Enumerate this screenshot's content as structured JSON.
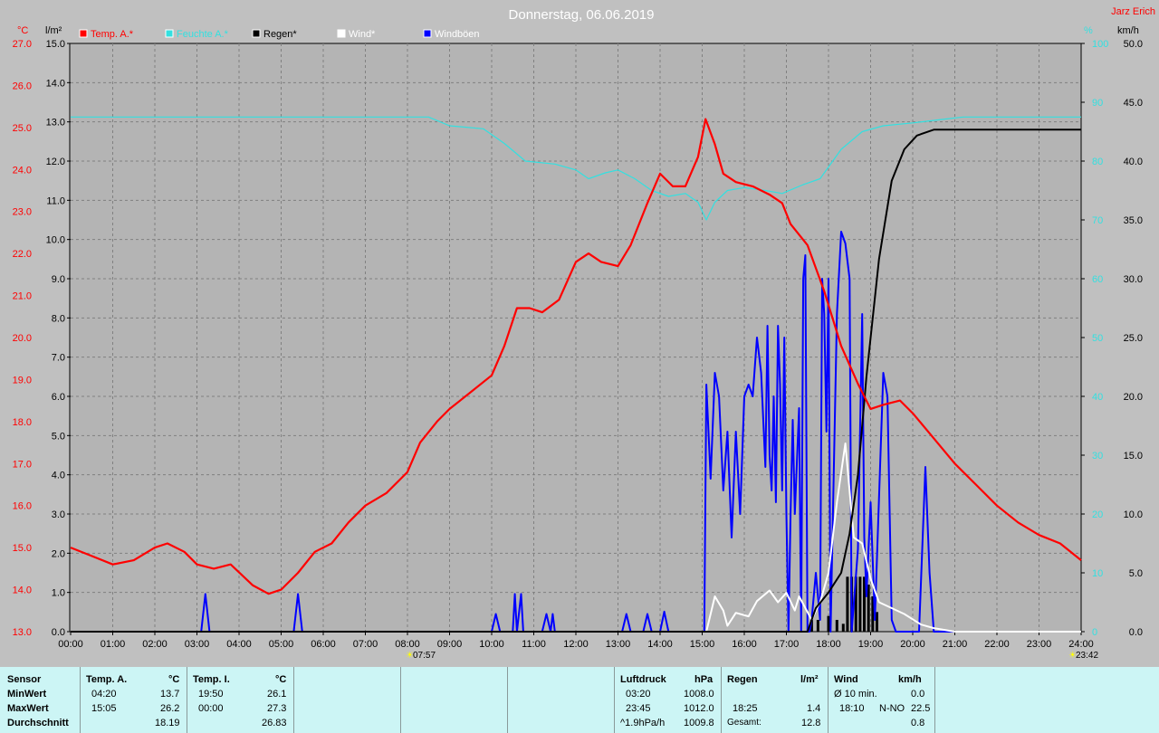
{
  "title": "Donnerstag, 06.06.2019",
  "author": "Jarz Erich",
  "colors": {
    "background": "#c0c0c0",
    "plot_bg": "#b4b4b4",
    "temp": "#ff0000",
    "humidity": "#33e0e0",
    "rain": "#000000",
    "wind": "#ffffff",
    "gusts": "#0000ff",
    "stats_bg": "#ccf5f5"
  },
  "axes": {
    "left_temp_unit": "°C",
    "left_rain_unit": "l/m²",
    "right_hum_unit": "%",
    "right_wind_unit": "km/h",
    "temp_ticks": [
      "27.0",
      "26.0",
      "25.0",
      "24.0",
      "23.0",
      "22.0",
      "21.0",
      "20.0",
      "19.0",
      "18.0",
      "17.0",
      "16.0",
      "15.0",
      "14.0",
      "13.0"
    ],
    "rain_ticks": [
      "15.0",
      "14.0",
      "13.0",
      "12.0",
      "11.0",
      "10.0",
      "9.0",
      "8.0",
      "7.0",
      "6.0",
      "5.0",
      "4.0",
      "3.0",
      "2.0",
      "1.0",
      "0.0"
    ],
    "hum_ticks": [
      "100",
      "90",
      "80",
      "70",
      "60",
      "50",
      "40",
      "30",
      "20",
      "10",
      "0"
    ],
    "wind_ticks": [
      "50.0",
      "45.0",
      "40.0",
      "35.0",
      "30.0",
      "25.0",
      "20.0",
      "15.0",
      "10.0",
      "5.0",
      "0.0"
    ],
    "x_ticks": [
      "00:00",
      "01:00",
      "02:00",
      "03:00",
      "04:00",
      "05:00",
      "06:00",
      "07:00",
      "08:00",
      "09:00",
      "10:00",
      "11:00",
      "12:00",
      "13:00",
      "14:00",
      "15:00",
      "16:00",
      "17:00",
      "18:00",
      "19:00",
      "20:00",
      "21:00",
      "22:00",
      "23:00",
      "24:00"
    ],
    "sunrise": "07:57",
    "sunset": "23:42"
  },
  "legend": {
    "items": [
      {
        "label": "Temp. A.*",
        "color": "#ff0000"
      },
      {
        "label": "Feuchte A.*",
        "color": "#33e0e0"
      },
      {
        "label": "Regen*",
        "color": "#000000"
      },
      {
        "label": "Wind*",
        "color": "#ffffff"
      },
      {
        "label": "Windböen",
        "color": "#0000ff"
      }
    ]
  },
  "chart_data": {
    "type": "line",
    "title": "Donnerstag, 06.06.2019",
    "x_unit": "hours",
    "x_range": [
      0,
      24
    ],
    "axis_ranges": {
      "temp": [
        13,
        27
      ],
      "rain": [
        0,
        15
      ],
      "humidity": [
        0,
        100
      ],
      "wind": [
        0,
        50
      ]
    },
    "grid": true,
    "legend_placement": "top",
    "series": [
      {
        "name": "Temp. A.*",
        "axis": "temp",
        "color": "#ff0000",
        "points": [
          [
            0,
            15.0
          ],
          [
            0.5,
            14.8
          ],
          [
            1,
            14.6
          ],
          [
            1.5,
            14.7
          ],
          [
            2,
            15.0
          ],
          [
            2.3,
            15.1
          ],
          [
            2.7,
            14.9
          ],
          [
            3,
            14.6
          ],
          [
            3.4,
            14.5
          ],
          [
            3.8,
            14.6
          ],
          [
            4.33,
            14.1
          ],
          [
            4.7,
            13.9
          ],
          [
            5,
            14.0
          ],
          [
            5.4,
            14.4
          ],
          [
            5.8,
            14.9
          ],
          [
            6.2,
            15.1
          ],
          [
            6.6,
            15.6
          ],
          [
            7,
            16.0
          ],
          [
            7.5,
            16.3
          ],
          [
            8,
            16.8
          ],
          [
            8.3,
            17.5
          ],
          [
            8.7,
            18.0
          ],
          [
            9,
            18.3
          ],
          [
            9.5,
            18.7
          ],
          [
            10,
            19.1
          ],
          [
            10.3,
            19.8
          ],
          [
            10.6,
            20.7
          ],
          [
            10.9,
            20.7
          ],
          [
            11.2,
            20.6
          ],
          [
            11.6,
            20.9
          ],
          [
            12,
            21.8
          ],
          [
            12.3,
            22.0
          ],
          [
            12.6,
            21.8
          ],
          [
            13,
            21.7
          ],
          [
            13.3,
            22.2
          ],
          [
            13.7,
            23.2
          ],
          [
            14,
            23.9
          ],
          [
            14.3,
            23.6
          ],
          [
            14.6,
            23.6
          ],
          [
            14.9,
            24.3
          ],
          [
            15.08,
            25.2
          ],
          [
            15.3,
            24.6
          ],
          [
            15.5,
            23.9
          ],
          [
            15.8,
            23.7
          ],
          [
            16.2,
            23.6
          ],
          [
            16.6,
            23.4
          ],
          [
            16.9,
            23.2
          ],
          [
            17.1,
            22.7
          ],
          [
            17.5,
            22.2
          ],
          [
            17.9,
            21.1
          ],
          [
            18.3,
            19.8
          ],
          [
            18.7,
            18.9
          ],
          [
            19,
            18.3
          ],
          [
            19.3,
            18.4
          ],
          [
            19.7,
            18.5
          ],
          [
            20,
            18.2
          ],
          [
            20.5,
            17.6
          ],
          [
            21,
            17.0
          ],
          [
            21.5,
            16.5
          ],
          [
            22,
            16.0
          ],
          [
            22.5,
            15.6
          ],
          [
            23,
            15.3
          ],
          [
            23.5,
            15.1
          ],
          [
            24,
            14.7
          ]
        ]
      },
      {
        "name": "Feuchte A.*",
        "axis": "humidity",
        "color": "#33e0e0",
        "points": [
          [
            0,
            87.5
          ],
          [
            8.5,
            87.5
          ],
          [
            9,
            86
          ],
          [
            9.8,
            85.5
          ],
          [
            10.3,
            83
          ],
          [
            10.8,
            80
          ],
          [
            11.5,
            79.5
          ],
          [
            12,
            78.5
          ],
          [
            12.3,
            77
          ],
          [
            12.7,
            78
          ],
          [
            13,
            78.5
          ],
          [
            13.4,
            77
          ],
          [
            13.8,
            75
          ],
          [
            14.2,
            74
          ],
          [
            14.6,
            74.5
          ],
          [
            14.9,
            73
          ],
          [
            15.1,
            70
          ],
          [
            15.3,
            73
          ],
          [
            15.6,
            75
          ],
          [
            16,
            75.5
          ],
          [
            16.5,
            75
          ],
          [
            16.9,
            74.5
          ],
          [
            17.4,
            76
          ],
          [
            17.8,
            77
          ],
          [
            18.3,
            82
          ],
          [
            18.8,
            85
          ],
          [
            19.3,
            86
          ],
          [
            20,
            86.5
          ],
          [
            20.6,
            87
          ],
          [
            21.2,
            87.5
          ],
          [
            24,
            87.5
          ]
        ]
      },
      {
        "name": "Regen*",
        "axis": "rain",
        "color": "#000000",
        "points": [
          [
            0,
            0
          ],
          [
            17.5,
            0
          ],
          [
            17.7,
            0.6
          ],
          [
            18,
            1.0
          ],
          [
            18.3,
            1.5
          ],
          [
            18.5,
            2.5
          ],
          [
            18.7,
            4.0
          ],
          [
            18.9,
            6.5
          ],
          [
            19.2,
            9.5
          ],
          [
            19.5,
            11.5
          ],
          [
            19.8,
            12.3
          ],
          [
            20.1,
            12.65
          ],
          [
            20.5,
            12.8
          ],
          [
            24,
            12.8
          ]
        ]
      },
      {
        "name": "Wind*",
        "axis": "wind",
        "color": "#ffffff",
        "points": [
          [
            0,
            0
          ],
          [
            15.1,
            0
          ],
          [
            15.3,
            3.0
          ],
          [
            15.5,
            1.8
          ],
          [
            15.6,
            0.5
          ],
          [
            15.8,
            1.6
          ],
          [
            16.1,
            1.3
          ],
          [
            16.3,
            2.6
          ],
          [
            16.6,
            3.5
          ],
          [
            16.8,
            2.5
          ],
          [
            17.0,
            3.3
          ],
          [
            17.2,
            1.8
          ],
          [
            17.3,
            3.0
          ],
          [
            17.6,
            1.0
          ],
          [
            17.8,
            2.5
          ],
          [
            18.0,
            5.0
          ],
          [
            18.2,
            11.0
          ],
          [
            18.4,
            16.0
          ],
          [
            18.6,
            8.0
          ],
          [
            18.8,
            7.5
          ],
          [
            19.0,
            4.5
          ],
          [
            19.2,
            2.5
          ],
          [
            19.5,
            2.0
          ],
          [
            19.8,
            1.5
          ],
          [
            20.2,
            0.6
          ],
          [
            20.5,
            0.3
          ],
          [
            21,
            0
          ],
          [
            24,
            0
          ]
        ]
      },
      {
        "name": "Windböen",
        "axis": "wind",
        "color": "#0000ff",
        "points": [
          [
            0,
            0
          ],
          [
            3.1,
            0
          ],
          [
            3.2,
            3.2
          ],
          [
            3.3,
            0
          ],
          [
            5.3,
            0
          ],
          [
            5.4,
            3.2
          ],
          [
            5.5,
            0
          ],
          [
            10.0,
            0
          ],
          [
            10.1,
            1.5
          ],
          [
            10.2,
            0
          ],
          [
            10.5,
            0
          ],
          [
            10.55,
            3.2
          ],
          [
            10.6,
            0
          ],
          [
            10.7,
            3.2
          ],
          [
            10.75,
            0
          ],
          [
            11.2,
            0
          ],
          [
            11.3,
            1.5
          ],
          [
            11.4,
            0
          ],
          [
            11.45,
            1.5
          ],
          [
            11.5,
            0
          ],
          [
            13.1,
            0
          ],
          [
            13.2,
            1.5
          ],
          [
            13.3,
            0
          ],
          [
            13.6,
            0
          ],
          [
            13.7,
            1.5
          ],
          [
            13.8,
            0
          ],
          [
            14.0,
            0
          ],
          [
            14.1,
            1.7
          ],
          [
            14.2,
            0
          ],
          [
            15.05,
            0
          ],
          [
            15.1,
            21
          ],
          [
            15.2,
            13
          ],
          [
            15.3,
            22
          ],
          [
            15.4,
            20
          ],
          [
            15.5,
            12
          ],
          [
            15.6,
            17
          ],
          [
            15.7,
            8
          ],
          [
            15.8,
            17
          ],
          [
            15.9,
            10
          ],
          [
            16.0,
            20
          ],
          [
            16.1,
            21
          ],
          [
            16.2,
            20
          ],
          [
            16.3,
            25
          ],
          [
            16.4,
            22
          ],
          [
            16.5,
            14
          ],
          [
            16.55,
            26
          ],
          [
            16.6,
            15
          ],
          [
            16.65,
            12
          ],
          [
            16.7,
            20
          ],
          [
            16.75,
            11
          ],
          [
            16.8,
            26
          ],
          [
            16.85,
            21
          ],
          [
            16.9,
            12
          ],
          [
            16.95,
            25
          ],
          [
            17.0,
            10
          ],
          [
            17.05,
            0
          ],
          [
            17.1,
            10
          ],
          [
            17.15,
            18
          ],
          [
            17.2,
            10
          ],
          [
            17.3,
            19
          ],
          [
            17.35,
            0
          ],
          [
            17.4,
            30
          ],
          [
            17.45,
            32
          ],
          [
            17.5,
            0
          ],
          [
            17.55,
            0
          ],
          [
            17.6,
            1
          ],
          [
            17.7,
            5
          ],
          [
            17.8,
            1
          ],
          [
            17.85,
            30
          ],
          [
            17.9,
            27
          ],
          [
            17.95,
            17
          ],
          [
            18.0,
            30
          ],
          [
            18.05,
            0
          ],
          [
            18.2,
            27
          ],
          [
            18.3,
            34
          ],
          [
            18.4,
            33
          ],
          [
            18.5,
            30
          ],
          [
            18.55,
            0
          ],
          [
            18.7,
            7
          ],
          [
            18.8,
            27
          ],
          [
            18.85,
            8
          ],
          [
            18.9,
            3
          ],
          [
            19.0,
            11
          ],
          [
            19.1,
            1
          ],
          [
            19.3,
            22
          ],
          [
            19.4,
            20
          ],
          [
            19.5,
            1
          ],
          [
            19.6,
            0
          ],
          [
            20.15,
            0
          ],
          [
            20.3,
            14
          ],
          [
            20.4,
            5
          ],
          [
            20.5,
            0
          ],
          [
            24,
            0
          ]
        ]
      }
    ],
    "rain_bars": {
      "axis": "rain",
      "color": "#000000",
      "points": [
        [
          17.6,
          0.3
        ],
        [
          17.75,
          0.3
        ],
        [
          18.0,
          0.4
        ],
        [
          18.2,
          0.3
        ],
        [
          18.35,
          0.2
        ],
        [
          18.45,
          1.4
        ],
        [
          18.55,
          1.4
        ],
        [
          18.65,
          1.4
        ],
        [
          18.75,
          1.4
        ],
        [
          18.85,
          1.4
        ],
        [
          18.95,
          1.2
        ],
        [
          19.05,
          0.9
        ],
        [
          19.15,
          0.5
        ]
      ]
    }
  },
  "stats": {
    "sensor": {
      "header": "Sensor",
      "min": "MinWert",
      "max": "MaxWert",
      "avg": "Durchschnitt"
    },
    "temp_a": {
      "header": "Temp. A.",
      "unit": "°C",
      "min_time": "04:20",
      "min_val": "13.7",
      "max_time": "15:05",
      "max_val": "26.2",
      "avg": "18.19"
    },
    "temp_i": {
      "header": "Temp. I.",
      "unit": "°C",
      "min_time": "19:50",
      "min_val": "26.1",
      "max_time": "00:00",
      "max_val": "27.3",
      "avg": "26.83"
    },
    "pressure": {
      "header": "Luftdruck",
      "unit": "hPa",
      "min_time": "03:20",
      "min_val": "1008.0",
      "max_time": "23:45",
      "max_val": "1012.0",
      "avg_label": "^1.9hPa/h",
      "avg": "1009.8"
    },
    "rain": {
      "header": "Regen",
      "unit": "l/m²",
      "max_time": "18:25",
      "max_val": "1.4",
      "total_label": "Gesamt:",
      "total": "12.8"
    },
    "wind": {
      "header": "Wind",
      "unit": "km/h",
      "min_label": "Ø 10 min.",
      "min_val": "0.0",
      "max_time": "18:10",
      "max_dir": "N-NO",
      "max_val": "22.5",
      "avg": "0.8"
    }
  }
}
